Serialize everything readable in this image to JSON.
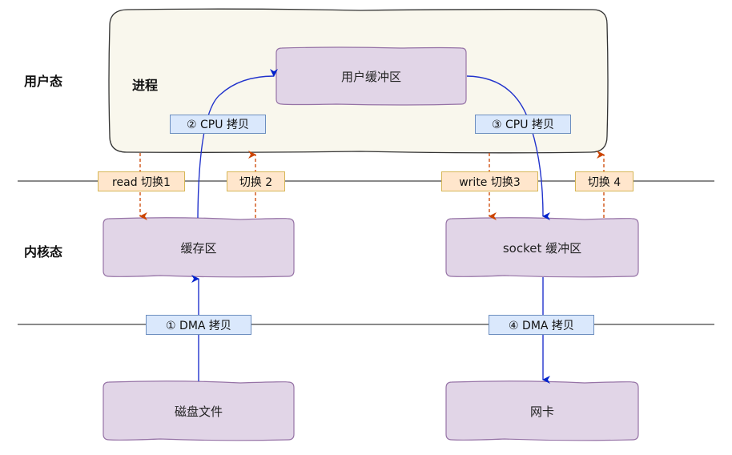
{
  "zones": {
    "user_mode": "用户态",
    "kernel_mode": "内核态"
  },
  "process": {
    "label": "进程",
    "user_buffer": "用户缓冲区"
  },
  "kernel": {
    "page_cache": "缓存区",
    "socket_buffer": "socket 缓冲区"
  },
  "hardware": {
    "disk_file": "磁盘文件",
    "nic": "网卡"
  },
  "copies": {
    "dma_1": "① DMA 拷贝",
    "cpu_2": "② CPU 拷贝",
    "cpu_3": "③ CPU 拷贝",
    "dma_4": "④ DMA 拷贝"
  },
  "context_switches": {
    "switch_1": "read 切换1",
    "switch_2": "切换 2",
    "switch_3": "write 切换3",
    "switch_4": "切换 4"
  },
  "colors": {
    "process_bg": "#f9f7ed",
    "buffer_fill": "#e1d5e7",
    "buffer_stroke": "#9673a6",
    "data_arrow": "#0000cc",
    "switch_arrow": "#cc4400",
    "cpu_tag_bg": "#dae8fc",
    "switch_tag_bg": "#ffe6cc"
  }
}
